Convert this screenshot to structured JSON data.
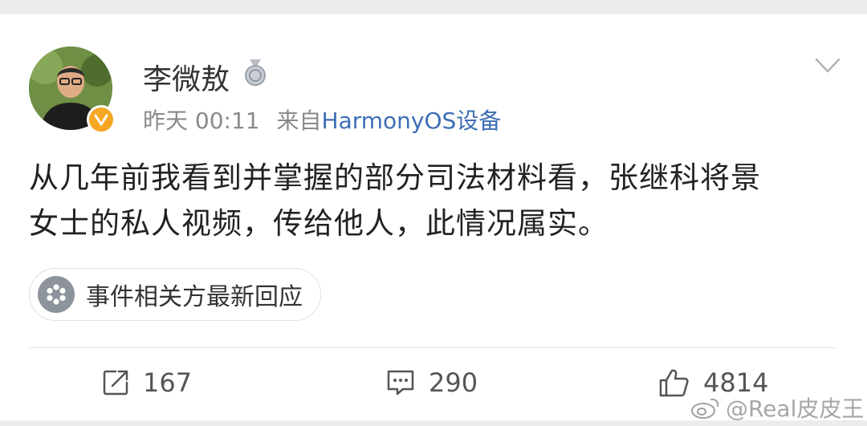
{
  "post": {
    "author_name": "李微敖",
    "timestamp": "昨天 00:11",
    "source_prefix": "来自",
    "source_device": "HarmonyOS设备",
    "body_line1": "从几年前我看到并掌握的部分司法材料看，张继科将景",
    "body_line2": "女士的私人视频，传给他人，此情况属实。",
    "topic_tag": "事件相关方最新回应"
  },
  "actions": {
    "repost_count": "167",
    "comment_count": "290",
    "like_count": "4814"
  },
  "watermark": {
    "text": "@Real皮皮王"
  },
  "icons": {
    "verified": "verified-badge-icon",
    "medal": "medal-icon",
    "more": "chevron-down-icon",
    "topic": "topic-icon",
    "repost": "repost-icon",
    "comment": "comment-icon",
    "like": "like-icon",
    "weibo": "weibo-logo-icon"
  },
  "colors": {
    "source_link": "#3d6eb5",
    "verified_badge": "#f5a623",
    "text_primary": "#222222",
    "text_meta": "#8a8a8a"
  }
}
